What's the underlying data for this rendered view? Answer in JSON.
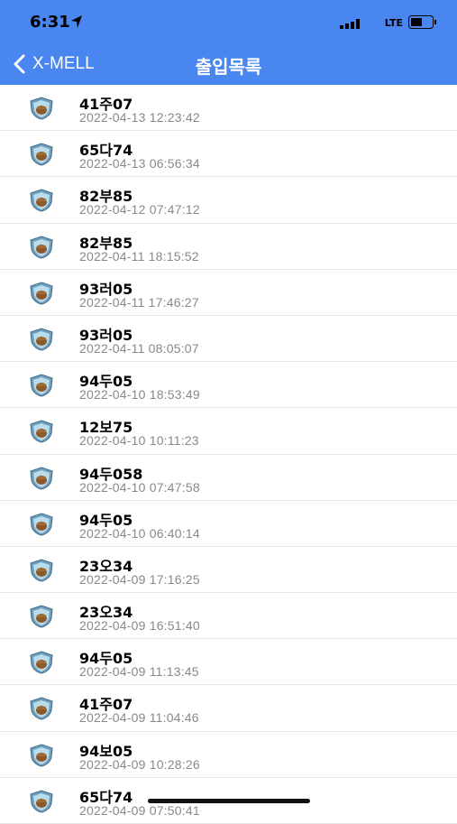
{
  "status_bar": {
    "time": "6:31",
    "network": "LTE",
    "icons": [
      "location-arrow-icon",
      "signal-bars-icon",
      "battery-icon"
    ]
  },
  "nav": {
    "back_label": "X-MELL",
    "title": "출입목록"
  },
  "colors": {
    "header": "#4a86ef",
    "plate_text": "#000000",
    "timestamp_text": "#888888"
  },
  "records": [
    {
      "plate": "41주07",
      "time": "2022-04-13 12:23:42"
    },
    {
      "plate": "65다74",
      "time": "2022-04-13 06:56:34"
    },
    {
      "plate": "82부85",
      "time": "2022-04-12 07:47:12"
    },
    {
      "plate": "82부85",
      "time": "2022-04-11 18:15:52"
    },
    {
      "plate": "93러05",
      "time": "2022-04-11 17:46:27"
    },
    {
      "plate": "93러05",
      "time": "2022-04-11 08:05:07"
    },
    {
      "plate": "94두05",
      "time": "2022-04-10 18:53:49"
    },
    {
      "plate": "12보75",
      "time": "2022-04-10 10:11:23"
    },
    {
      "plate": "94두058",
      "time": "2022-04-10 07:47:58"
    },
    {
      "plate": "94두05",
      "time": "2022-04-10 06:40:14"
    },
    {
      "plate": "23오34",
      "time": "2022-04-09 17:16:25"
    },
    {
      "plate": "23오34",
      "time": "2022-04-09 16:51:40"
    },
    {
      "plate": "94두05",
      "time": "2022-04-09 11:13:45"
    },
    {
      "plate": "41주07",
      "time": "2022-04-09 11:04:46"
    },
    {
      "plate": "94보05",
      "time": "2022-04-09 10:28:26"
    },
    {
      "plate": "65다74",
      "time": "2022-04-09 07:50:41"
    }
  ]
}
